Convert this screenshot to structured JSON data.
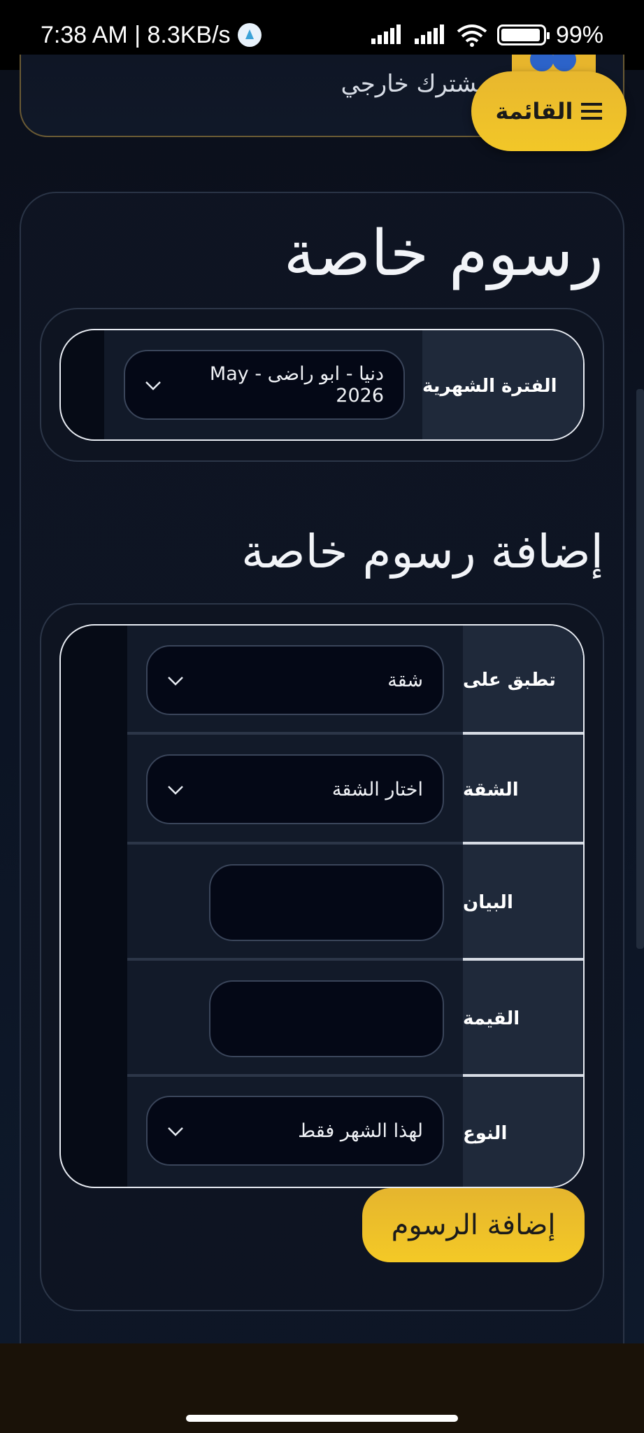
{
  "status_bar": {
    "time_speed": "7:38 AM | 8.3KB/s",
    "battery": "99%"
  },
  "header": {
    "partial_text": "مشترك خارجي",
    "menu_label": "القائمة"
  },
  "page": {
    "title": "رسوم خاصة",
    "period_label": "الفترة الشهرية",
    "period_value": "دنيا - ابو راضى - May 2026",
    "add_section_title": "إضافة رسوم خاصة"
  },
  "form": {
    "apply_to_label": "تطبق على",
    "apply_to_value": "شقة",
    "apartment_label": "الشقة",
    "apartment_value": "اختار الشقة",
    "description_label": "البيان",
    "description_value": "",
    "amount_label": "القيمة",
    "amount_value": "",
    "type_label": "النوع",
    "type_value": "لهذا الشهر فقط",
    "submit_label": "إضافة الرسوم"
  },
  "colors": {
    "accent": "#f0c22a",
    "background": "#0c1322",
    "label_cell": "#1f293a"
  },
  "icons": [
    "signal-icon",
    "wifi-icon",
    "battery-icon",
    "menu-icon",
    "chevron-down-icon"
  ]
}
